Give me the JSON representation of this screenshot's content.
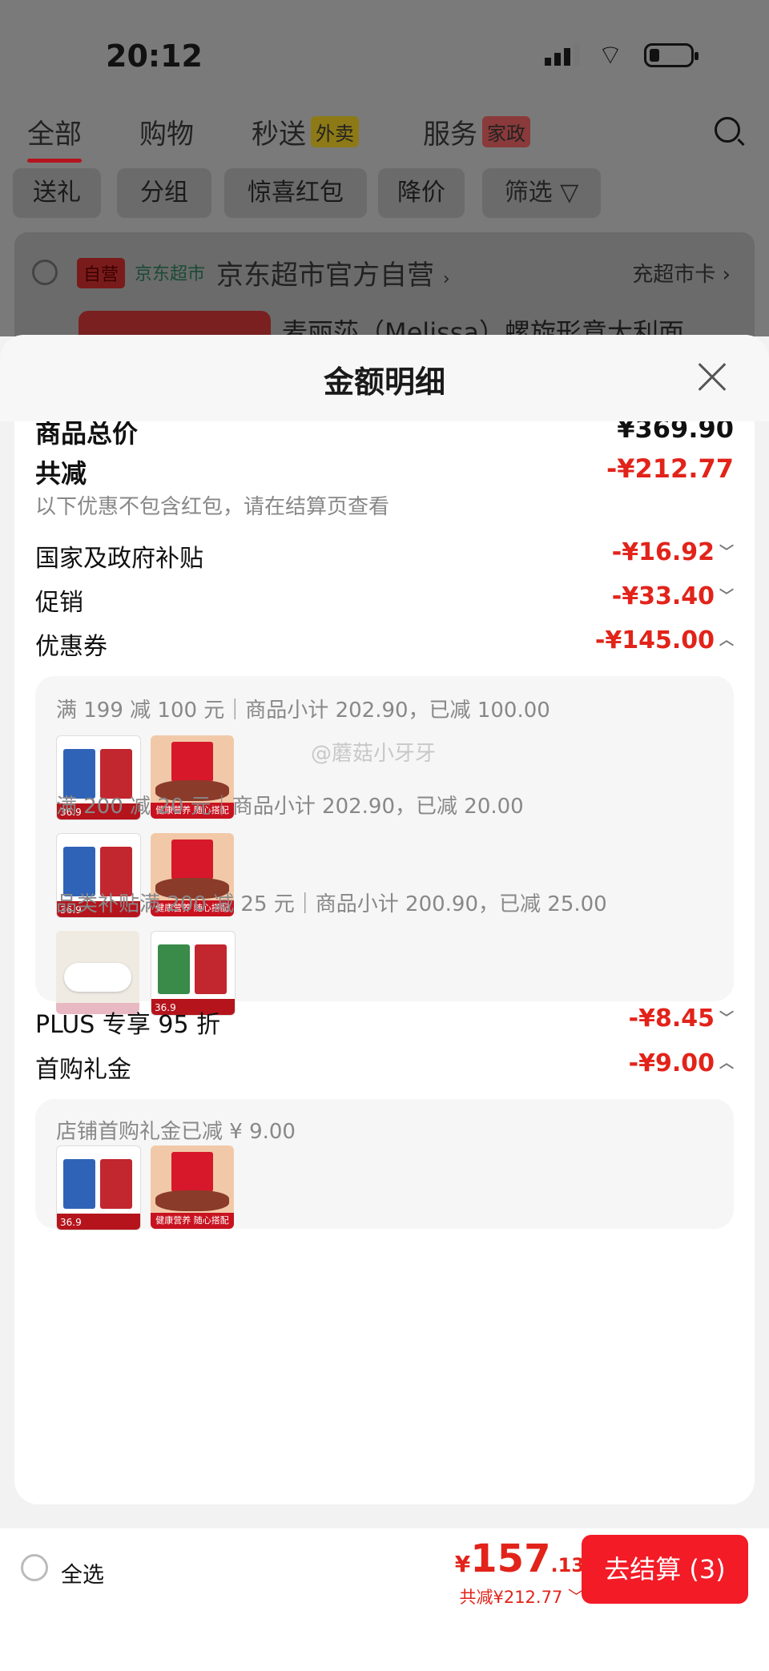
{
  "status_bar": {
    "time": "20:12"
  },
  "top_tabs": [
    {
      "label": "全部"
    },
    {
      "label": "购物"
    },
    {
      "label": "秒送",
      "badge": "外卖"
    },
    {
      "label": "服务",
      "badge": "家政"
    }
  ],
  "filters": [
    "送礼",
    "分组",
    "惊喜红包",
    "降价",
    "筛选"
  ],
  "store": {
    "self_tag": "自营",
    "channel": "京东超市",
    "name": "京东超市官方自营",
    "card_link": "充超市卡",
    "product_title_partial": "麦丽莎（Melissa）螺旋形意大利面"
  },
  "sheet": {
    "title": "金额明细",
    "goods_total_label": "商品总价",
    "goods_total": "¥369.90",
    "discount_label": "共减",
    "discount_total": "-¥212.77",
    "note": "以下优惠不包含红包，请在结算页查看",
    "items": [
      {
        "label": "国家及政府补贴",
        "value": "-¥16.92"
      },
      {
        "label": "促销",
        "value": "-¥33.40"
      },
      {
        "label": "优惠券",
        "value": "-¥145.00"
      }
    ],
    "coupons": [
      "满 199 减 100 元｜商品小计 202.90，已减 100.00",
      "满 200 减 20 元｜商品小计 202.90，已减 20.00",
      "品类补贴满 200 减 25 元｜商品小计 200.90，已减 25.00"
    ],
    "thumb_labels": {
      "pasta_price": "36.9",
      "gift_caption": "健康营养 随心搭配"
    },
    "plus": {
      "label": "PLUS 专享 95 折",
      "value": "-¥8.45"
    },
    "first_gift": {
      "label": "首购礼金",
      "value": "-¥9.00",
      "detail": "店铺首购礼金已减 ¥ 9.00"
    },
    "watermark": "@蘑菇小牙牙"
  },
  "footer": {
    "select_all": "全选",
    "currency": "¥",
    "price_int": "157",
    "price_dec": ".13",
    "saved": "共减¥212.77",
    "checkout": "去结算 (3)"
  },
  "colors": {
    "accent": "#e2231a",
    "button": "#f31b26",
    "brand_dark": "#b3141e"
  }
}
